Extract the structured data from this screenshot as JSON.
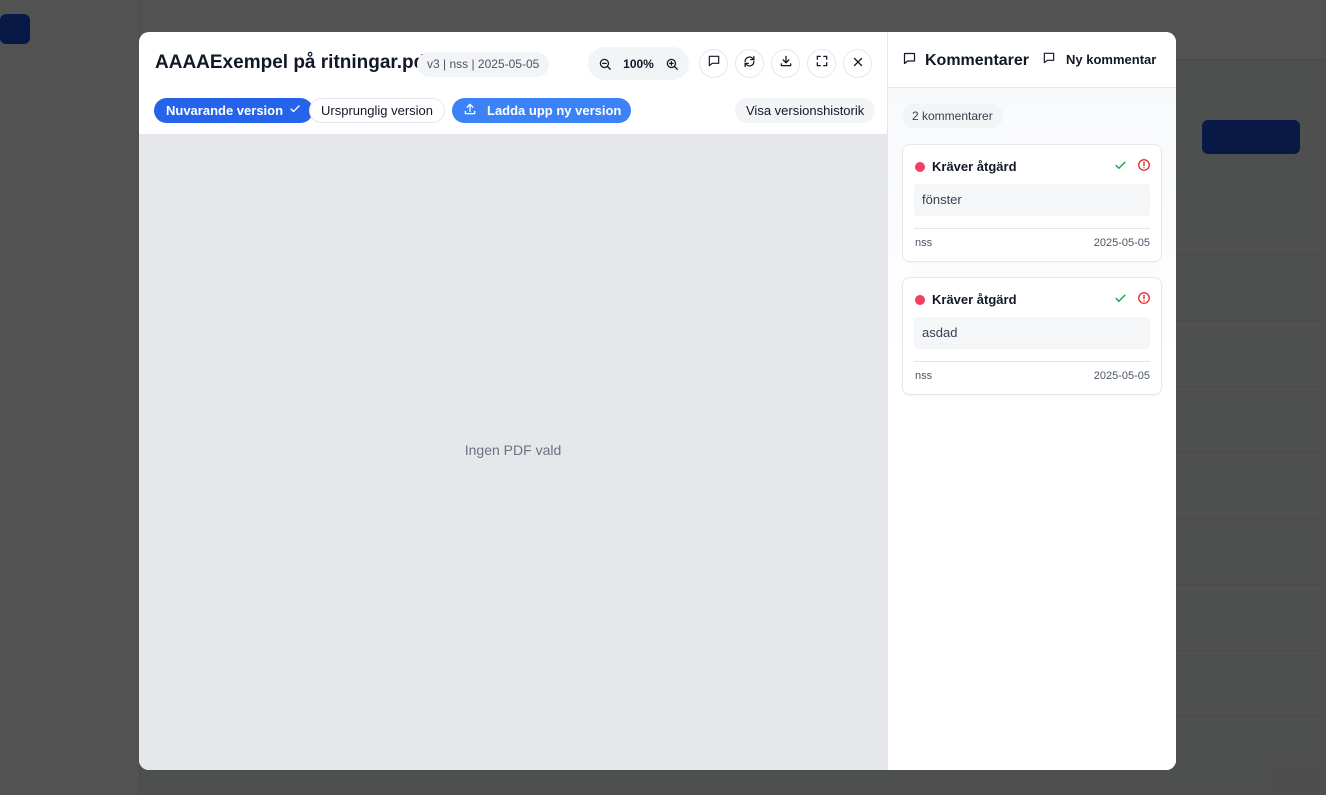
{
  "modal": {
    "file_name": "AAAAExempel på ritningar.pdf",
    "meta": "v3 | nss | 2025-05-05",
    "zoom_level": "100%",
    "buttons": {
      "current_version": "Nuvarande version",
      "original_version": "Ursprunglig version",
      "upload_new_version": "Ladda upp ny version",
      "version_history": "Visa versionshistorik"
    },
    "empty_state": "Ingen PDF vald"
  },
  "comments": {
    "title": "Kommentarer",
    "new_comment": "Ny kommentar",
    "count_label": "2 kommentarer",
    "items": [
      {
        "status": "Kräver åtgärd",
        "text": "fönster",
        "author": "nss",
        "date": "2025-05-05"
      },
      {
        "status": "Kräver åtgärd",
        "text": "asdad",
        "author": "nss",
        "date": "2025-05-05"
      }
    ]
  },
  "colors": {
    "primary": "#2563eb",
    "upload": "#3b82f6",
    "status_dot": "#f43f5e",
    "resolve_check": "#16a34a",
    "alert": "#dc2626",
    "overlay": "rgba(0,0,0,0.68)"
  },
  "icons": [
    "zoom-out-icon",
    "zoom-in-icon",
    "comment-icon",
    "rotate-icon",
    "download-icon",
    "fullscreen-icon",
    "close-icon",
    "check-icon",
    "upload-icon",
    "check-circle-icon",
    "alert-circle-icon"
  ]
}
